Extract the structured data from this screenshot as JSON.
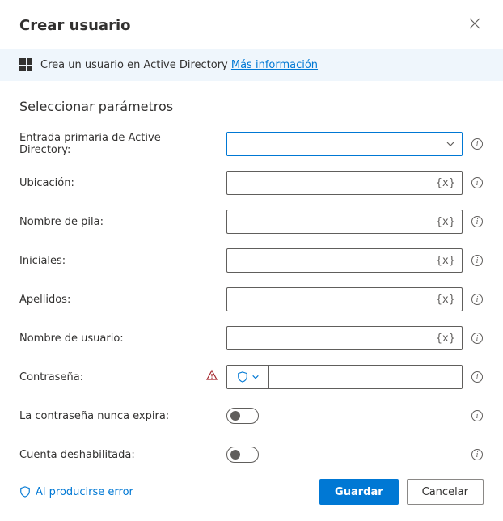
{
  "header": {
    "title": "Crear usuario"
  },
  "banner": {
    "text": "Crea un usuario en Active Directory",
    "link": "Más información"
  },
  "section_title": "Seleccionar parámetros",
  "var_token": "{x}",
  "fields": {
    "ad_entry": {
      "label": "Entrada primaria de Active Directory:"
    },
    "location": {
      "label": "Ubicación:"
    },
    "first_name": {
      "label": "Nombre de pila:"
    },
    "initials": {
      "label": "Iniciales:"
    },
    "last_name": {
      "label": "Apellidos:"
    },
    "username": {
      "label": "Nombre de usuario:"
    },
    "password": {
      "label": "Contraseña:"
    },
    "never_expires": {
      "label": "La contraseña nunca expira:"
    },
    "disabled": {
      "label": "Cuenta deshabilitada:"
    }
  },
  "footer": {
    "on_error": "Al producirse error",
    "save": "Guardar",
    "cancel": "Cancelar"
  }
}
